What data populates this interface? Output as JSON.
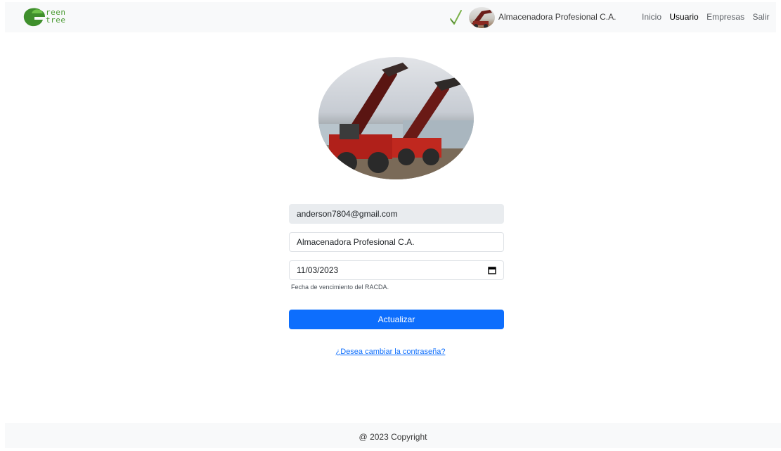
{
  "navbar": {
    "brand": {
      "line1": "reen",
      "line2": "tree"
    },
    "company_name": "Almacenadora Profesional C.A.",
    "links": [
      {
        "label": "Inicio",
        "active": false
      },
      {
        "label": "Usuario",
        "active": true
      },
      {
        "label": "Empresas",
        "active": false
      },
      {
        "label": "Salir",
        "active": false
      }
    ]
  },
  "form": {
    "email": "anderson7804@gmail.com",
    "company": "Almacenadora Profesional C.A.",
    "date": "11/03/2023",
    "date_help": "Fecha de vencimiento del RACDA.",
    "submit_label": "Actualizar",
    "change_password_link": "¿Desea cambiar la contraseña?"
  },
  "footer": {
    "text": "@ 2023 Copyright"
  },
  "colors": {
    "primary": "#0d6efd",
    "brand_green": "#4a9a32",
    "navbar_bg": "#f8f9fa"
  }
}
